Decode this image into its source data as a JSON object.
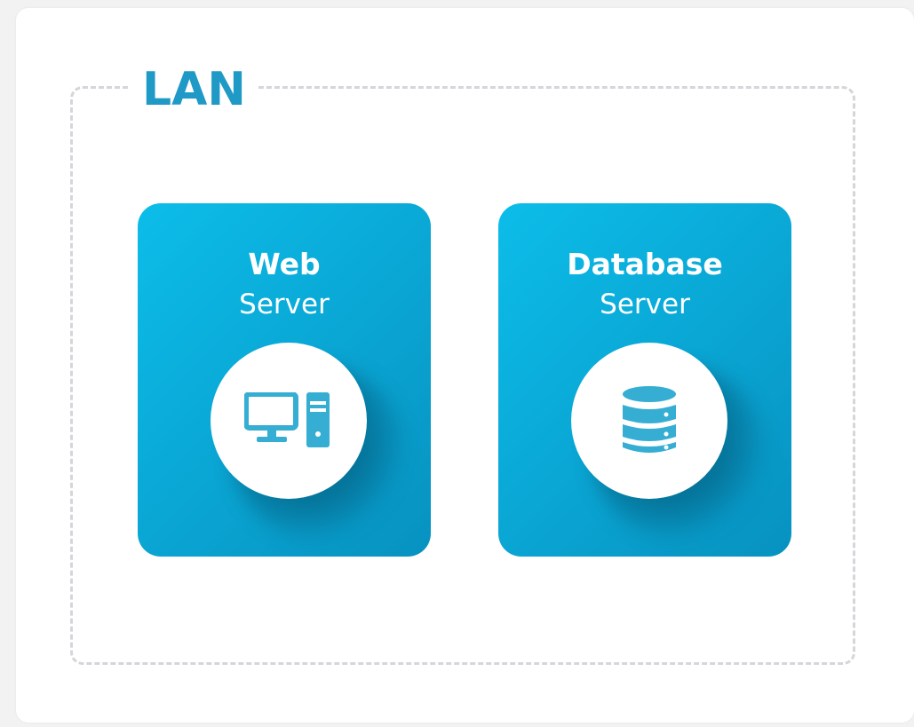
{
  "diagram": {
    "group": {
      "title": "LAN"
    },
    "nodes": [
      {
        "title": "Web",
        "subtitle": "Server",
        "icon": "computer-icon"
      },
      {
        "title": "Database",
        "subtitle": "Server",
        "icon": "database-icon"
      }
    ]
  },
  "colors": {
    "accent": "#1f9ac6",
    "card_gradient_start": "#0cbde9",
    "card_gradient_end": "#0792c0",
    "icon": "#36aed3",
    "border": "#d5d6da"
  }
}
